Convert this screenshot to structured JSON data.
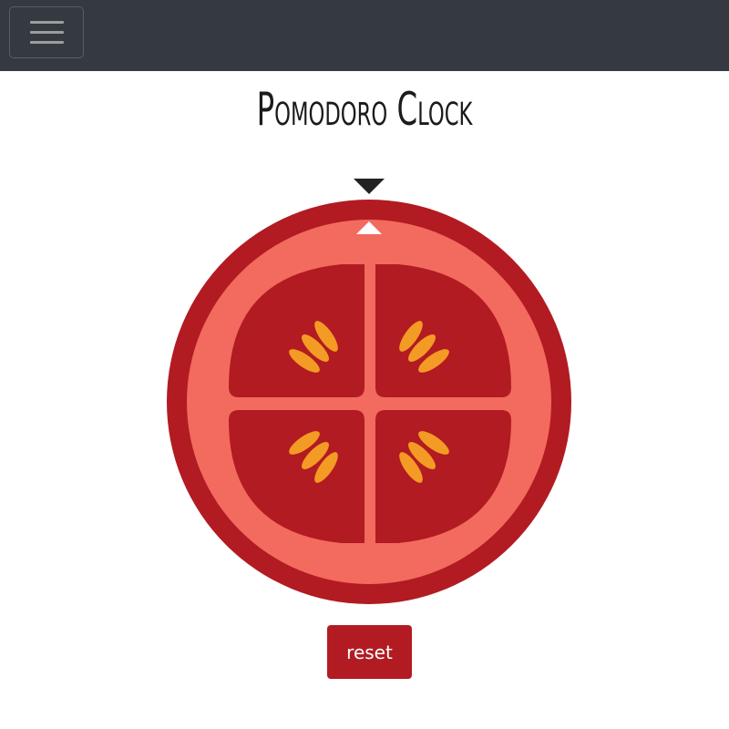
{
  "navbar": {
    "menu_icon": "hamburger-menu-icon"
  },
  "header": {
    "title": "Pomodoro Clock"
  },
  "timer": {
    "marker_icon": "triangle-down-icon",
    "dial_pointer_icon": "triangle-up-icon",
    "tomato_icon": "tomato-slice-icon"
  },
  "controls": {
    "reset_label": "reset"
  },
  "colors": {
    "navbar_bg": "#343a40",
    "tomato_skin": "#b21b22",
    "tomato_flesh": "#f26b5e",
    "tomato_chamber": "#b21b22",
    "seed": "#f39b24",
    "button_bg": "#b21b22"
  }
}
